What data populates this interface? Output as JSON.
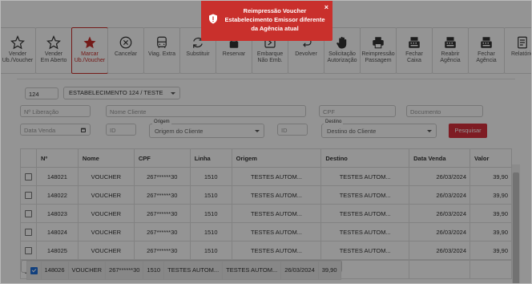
{
  "toolbar": [
    {
      "label": "Vender\nUb./Voucher",
      "icon": "star-outline-icon"
    },
    {
      "label": "Vender\nEm Aberto",
      "icon": "star-outline-icon"
    },
    {
      "label": "Marcar\nUb./Voucher",
      "icon": "star-filled-icon",
      "active": true
    },
    {
      "label": "Cancelar",
      "icon": "cancel-circle-icon"
    },
    {
      "label": "Viag. Extra",
      "icon": "bus-icon"
    },
    {
      "label": "Substituir",
      "icon": "refresh-icon"
    },
    {
      "label": "Reservar",
      "icon": "lock-icon"
    },
    {
      "label": "Embarque\nNão Emb.",
      "icon": "boarding-icon"
    },
    {
      "label": "Devolver",
      "icon": "return-icon"
    },
    {
      "label": "Solicitação\nAutorização",
      "icon": "hand-icon"
    },
    {
      "label": "Reimpressão\nPassagem",
      "icon": "printer-icon"
    },
    {
      "label": "Fechar\nCaixa",
      "icon": "cash-register-icon"
    },
    {
      "label": "Reabrir\nAgência",
      "icon": "cash-register-icon"
    },
    {
      "label": "Fechar\nAgência",
      "icon": "cash-register-icon"
    },
    {
      "label": "Relatório",
      "icon": "report-icon"
    }
  ],
  "filters": {
    "agency_code": "124",
    "establishment": "ESTABELECIMENTO 124 / TESTE",
    "liberacao_placeholder": "Nº Liberação",
    "nome_placeholder": "Nome Cliente",
    "cpf_placeholder": "CPF",
    "documento_placeholder": "Documento",
    "data_venda_placeholder": "Data Venda",
    "id_placeholder": "ID",
    "origem_label": "Origem",
    "origem_value": "Origem do Cliente",
    "id2_placeholder": "ID",
    "destino_label": "Destino",
    "destino_value": "Destino do Cliente",
    "search_label": "Pesquisar"
  },
  "table": {
    "headers": [
      "",
      "Nº",
      "Nome",
      "CPF",
      "Linha",
      "Origem",
      "Destino",
      "Data Venda",
      "Valor"
    ],
    "rows": [
      {
        "checked": false,
        "num": "148021",
        "nome": "VOUCHER",
        "cpf": "267******30",
        "linha": "1510",
        "origem": "TESTES AUTOM...",
        "destino": "TESTES AUTOM...",
        "data": "26/03/2024",
        "valor": "39,90"
      },
      {
        "checked": false,
        "num": "148022",
        "nome": "VOUCHER",
        "cpf": "267******30",
        "linha": "1510",
        "origem": "TESTES AUTOM...",
        "destino": "TESTES AUTOM...",
        "data": "26/03/2024",
        "valor": "39,90"
      },
      {
        "checked": false,
        "num": "148023",
        "nome": "VOUCHER",
        "cpf": "267******30",
        "linha": "1510",
        "origem": "TESTES AUTOM...",
        "destino": "TESTES AUTOM...",
        "data": "26/03/2024",
        "valor": "39,90"
      },
      {
        "checked": false,
        "num": "148024",
        "nome": "VOUCHER",
        "cpf": "267******30",
        "linha": "1510",
        "origem": "TESTES AUTOM...",
        "destino": "TESTES AUTOM...",
        "data": "26/03/2024",
        "valor": "39,90"
      },
      {
        "checked": false,
        "num": "148025",
        "nome": "VOUCHER",
        "cpf": "267******30",
        "linha": "1510",
        "origem": "TESTES AUTOM...",
        "destino": "TESTES AUTOM...",
        "data": "26/03/2024",
        "valor": "39,90"
      },
      {
        "checked": true,
        "num": "148026",
        "nome": "VOUCHER",
        "cpf": "267******30",
        "linha": "1510",
        "origem": "TESTES AUTOM...",
        "destino": "TESTES AUTOM...",
        "data": "26/03/2024",
        "valor": "39,90"
      }
    ]
  },
  "toast": {
    "title": "Reimpressão Voucher",
    "message": "Estabelecimento Emissor diferente da Agência atual",
    "close": "×",
    "icon": "shield-alert-icon",
    "color": "#c9302c"
  }
}
